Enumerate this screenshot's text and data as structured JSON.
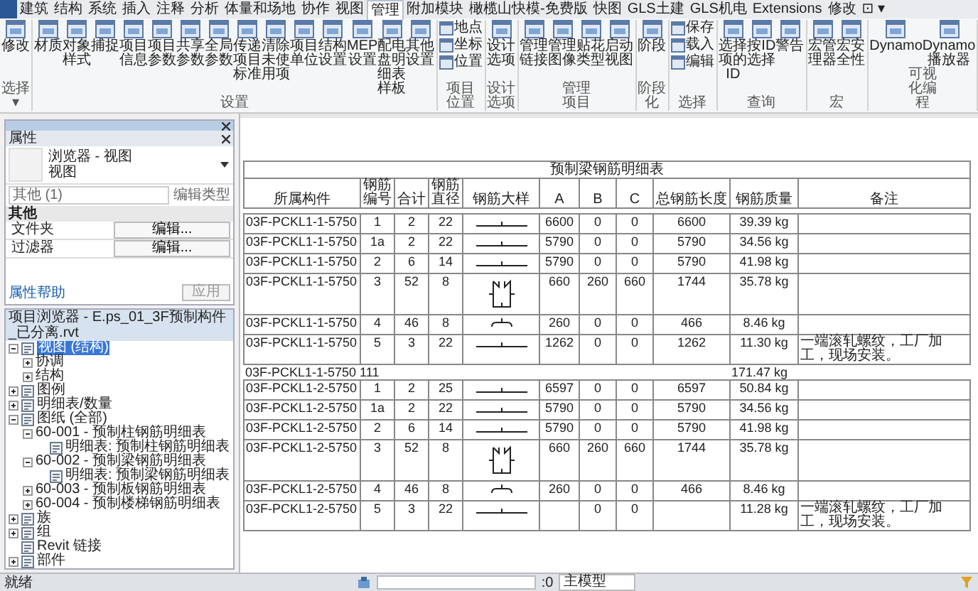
{
  "ribbon": {
    "tabs": [
      {
        "label": "建筑",
        "selected": false
      },
      {
        "label": "结构",
        "selected": false
      },
      {
        "label": "系统",
        "selected": false
      },
      {
        "label": "插入",
        "selected": false
      },
      {
        "label": "注释",
        "selected": false
      },
      {
        "label": "分析",
        "selected": false
      },
      {
        "label": "体量和场地",
        "selected": false
      },
      {
        "label": "协作",
        "selected": false
      },
      {
        "label": "视图",
        "selected": false
      },
      {
        "label": "管理",
        "selected": true
      },
      {
        "label": "附加模块",
        "selected": false
      },
      {
        "label": "橄榄山快模-免费版",
        "selected": false
      },
      {
        "label": "快图",
        "selected": false
      },
      {
        "label": "GLS土建",
        "selected": false
      },
      {
        "label": "GLS机电",
        "selected": false
      },
      {
        "label": "Extensions",
        "selected": false
      },
      {
        "label": "修改",
        "selected": false
      },
      {
        "label": "⊡ ▾",
        "selected": false
      }
    ],
    "panels": [
      {
        "title": "选择 ▾",
        "kind": "large",
        "buttons": [
          {
            "label": "修改"
          }
        ]
      },
      {
        "title": "设置",
        "kind": "large",
        "buttons": [
          {
            "label": "材质"
          },
          {
            "label": "对象样式"
          },
          {
            "label": "捕捉"
          },
          {
            "label": "项目信息"
          },
          {
            "label": "项目参数"
          },
          {
            "label": "共享参数"
          },
          {
            "label": "全局参数"
          },
          {
            "label": "传递项目标准"
          },
          {
            "label": "清除未使用项"
          },
          {
            "label": "项目单位"
          },
          {
            "label": "结构设置"
          },
          {
            "label": "MEP设置"
          },
          {
            "label": "配电盘明细表样板"
          },
          {
            "label": "其他设置"
          }
        ]
      },
      {
        "title": "项目位置",
        "kind": "stack",
        "buttons": [
          {
            "label": "地点"
          },
          {
            "label": "坐标"
          },
          {
            "label": "位置"
          }
        ]
      },
      {
        "title": "设计选项",
        "kind": "large",
        "buttons": [
          {
            "label": "设计选项"
          }
        ]
      },
      {
        "title": "管理项目",
        "kind": "large",
        "buttons": [
          {
            "label": "管理链接"
          },
          {
            "label": "管理图像"
          },
          {
            "label": "贴花类型"
          },
          {
            "label": "启动视图"
          }
        ]
      },
      {
        "title": "阶段化",
        "kind": "large",
        "buttons": [
          {
            "label": "阶段"
          }
        ]
      },
      {
        "title": "选择",
        "kind": "stack",
        "buttons": [
          {
            "label": "保存"
          },
          {
            "label": "载入"
          },
          {
            "label": "编辑"
          }
        ]
      },
      {
        "title": "查询",
        "kind": "large",
        "buttons": [
          {
            "label": "选择项的ID"
          },
          {
            "label": "按ID选择"
          },
          {
            "label": "警告"
          }
        ]
      },
      {
        "title": "宏",
        "kind": "large",
        "buttons": [
          {
            "label": "宏管理器"
          },
          {
            "label": "宏安全性"
          }
        ]
      },
      {
        "title": "可视化编程",
        "kind": "large",
        "buttons": [
          {
            "label": "Dynamo"
          },
          {
            "label": "Dynamo 播放器"
          }
        ]
      }
    ]
  },
  "properties": {
    "title": "属性",
    "type_name": "浏览器 - 视图",
    "type_sub": "视图",
    "instance": "其他 (1)",
    "edit_type": "编辑类型",
    "section": "其他",
    "rows": [
      {
        "label": "文件夹",
        "value": "编辑..."
      },
      {
        "label": "过滤器",
        "value": "编辑..."
      }
    ],
    "help": "属性帮助",
    "apply": {
      "label": "应用",
      "disabled": true
    }
  },
  "browser": {
    "title": "项目浏览器 - E.ps_01_3F预制构件_已分离.rvt",
    "tree": [
      {
        "label": "视图 (结构)",
        "icon": true,
        "expanded": true,
        "selected": true,
        "children": [
          {
            "label": "协调",
            "icon": false,
            "expanded": false,
            "selected": false
          },
          {
            "label": "结构",
            "icon": false,
            "expanded": false,
            "selected": false
          }
        ]
      },
      {
        "label": "图例",
        "icon": true,
        "expanded": false,
        "selected": false
      },
      {
        "label": "明细表/数量",
        "icon": true,
        "expanded": false,
        "selected": false
      },
      {
        "label": "图纸 (全部)",
        "icon": true,
        "expanded": true,
        "selected": false,
        "children": [
          {
            "label": "60-001 - 预制柱钢筋明细表",
            "icon": false,
            "expanded": true,
            "selected": false,
            "children": [
              {
                "label": "明细表: 预制柱钢筋明细表",
                "icon": true,
                "selected": false
              }
            ]
          },
          {
            "label": "60-002 - 预制梁钢筋明细表",
            "icon": false,
            "expanded": true,
            "selected": false,
            "children": [
              {
                "label": "明细表: 预制梁钢筋明细表",
                "icon": true,
                "selected": false
              }
            ]
          },
          {
            "label": "60-003 - 预制板钢筋明细表",
            "icon": false,
            "expanded": false,
            "selected": false
          },
          {
            "label": "60-004 - 预制楼梯钢筋明细表",
            "icon": false,
            "expanded": false,
            "selected": false
          }
        ]
      },
      {
        "label": "族",
        "icon": true,
        "expanded": false,
        "selected": false
      },
      {
        "label": "组",
        "icon": true,
        "expanded": false,
        "selected": false
      },
      {
        "label": "Revit 链接",
        "icon": true,
        "selected": false
      },
      {
        "label": "部件",
        "icon": true,
        "expanded": false,
        "selected": false
      }
    ]
  },
  "schedule": {
    "title": "预制梁钢筋明细表",
    "columns": [
      "所属构件",
      "钢筋编号",
      "合计",
      "钢筋直径",
      "钢筋大样",
      "A",
      "B",
      "C",
      "总钢筋长度",
      "钢筋质量",
      "备注"
    ],
    "groups": [
      {
        "rows": [
          {
            "member": "03F-PCKL1-1-5750",
            "mark": "1",
            "count": "2",
            "dia": "22",
            "kind": "straight",
            "a": "6600",
            "b": "0",
            "c": "0",
            "total": "6600",
            "mass": "39.39 kg"
          },
          {
            "member": "03F-PCKL1-1-5750",
            "mark": "1a",
            "count": "2",
            "dia": "22",
            "kind": "straight",
            "a": "5790",
            "b": "0",
            "c": "0",
            "total": "5790",
            "mass": "34.56 kg"
          },
          {
            "member": "03F-PCKL1-1-5750",
            "mark": "2",
            "count": "6",
            "dia": "14",
            "kind": "straight",
            "a": "5790",
            "b": "0",
            "c": "0",
            "total": "5790",
            "mass": "41.98 kg"
          },
          {
            "member": "03F-PCKL1-1-5750",
            "mark": "3",
            "count": "52",
            "dia": "8",
            "kind": "stirrup",
            "a": "660",
            "b": "260",
            "c": "660",
            "total": "1744",
            "mass": "35.78 kg"
          },
          {
            "member": "03F-PCKL1-1-5750",
            "mark": "4",
            "count": "46",
            "dia": "8",
            "kind": "hook",
            "a": "260",
            "b": "0",
            "c": "0",
            "total": "466",
            "mass": "8.46 kg"
          },
          {
            "member": "03F-PCKL1-1-5750",
            "mark": "5",
            "count": "3",
            "dia": "22",
            "kind": "straight",
            "a": "1262",
            "b": "0",
            "c": "0",
            "total": "1262",
            "mass": "11.30 kg",
            "note": "一端滚轧螺纹，工厂加工，现场安装。"
          }
        ],
        "summary": {
          "member": "03F-PCKL1-1-5750",
          "count": "111",
          "mass": "171.47 kg"
        }
      },
      {
        "rows": [
          {
            "member": "03F-PCKL1-2-5750",
            "mark": "1",
            "count": "2",
            "dia": "25",
            "kind": "straight",
            "a": "6597",
            "b": "0",
            "c": "0",
            "total": "6597",
            "mass": "50.84 kg"
          },
          {
            "member": "03F-PCKL1-2-5750",
            "mark": "1a",
            "count": "2",
            "dia": "22",
            "kind": "straight",
            "a": "5790",
            "b": "0",
            "c": "0",
            "total": "5790",
            "mass": "34.56 kg"
          },
          {
            "member": "03F-PCKL1-2-5750",
            "mark": "2",
            "count": "6",
            "dia": "14",
            "kind": "straight",
            "a": "5790",
            "b": "0",
            "c": "0",
            "total": "5790",
            "mass": "41.98 kg"
          },
          {
            "member": "03F-PCKL1-2-5750",
            "mark": "3",
            "count": "52",
            "dia": "8",
            "kind": "stirrup",
            "a": "660",
            "b": "260",
            "c": "660",
            "total": "1744",
            "mass": "35.78 kg"
          },
          {
            "member": "03F-PCKL1-2-5750",
            "mark": "4",
            "count": "46",
            "dia": "8",
            "kind": "hook",
            "a": "260",
            "b": "0",
            "c": "0",
            "total": "466",
            "mass": "8.46 kg"
          },
          {
            "member": "03F-PCKL1-2-5750",
            "mark": "5",
            "count": "3",
            "dia": "22",
            "kind": "straight",
            "b": "0",
            "c": "0",
            "mass": "11.28 kg",
            "note": "一端滚轧螺纹，工厂加工，现场安装。"
          }
        ]
      }
    ]
  },
  "status_bar": {
    "text": "就绪",
    "coordinate": ":0",
    "model": "主模型"
  }
}
